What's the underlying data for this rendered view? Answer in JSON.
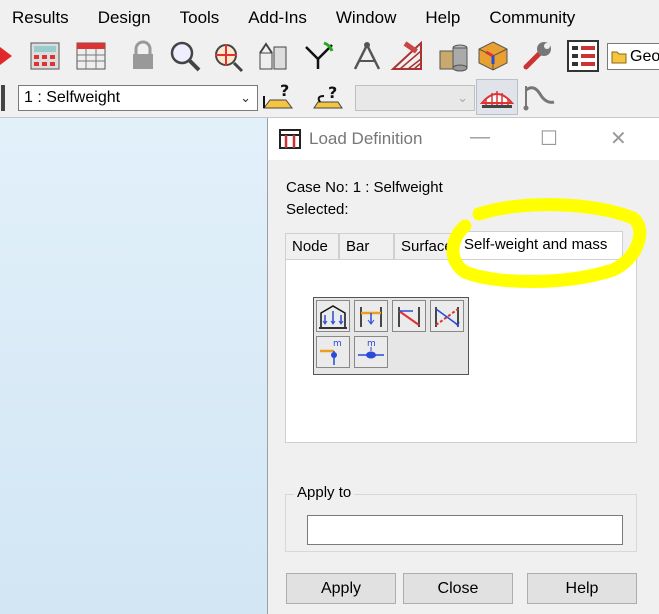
{
  "menu": [
    "Results",
    "Design",
    "Tools",
    "Add-Ins",
    "Window",
    "Help",
    "Community"
  ],
  "toolbar": {
    "load_case_value": "1 : Selfweight",
    "truncated_combo_text": "Geo",
    "icons": [
      "calculator-icon",
      "tables-icon",
      "lock-icon",
      "zoom-icon",
      "pan-icon",
      "structure-icon",
      "supports-icon",
      "measure-icon",
      "truss-icon",
      "cylinder-icon",
      "cube-icon",
      "wrench-icon",
      "layout-icon"
    ]
  },
  "dialog": {
    "title": "Load Definition",
    "case_label": "Case No: 1 : Selfweight",
    "selected_label": "Selected:",
    "tabs": [
      "Node",
      "Bar",
      "Surface",
      "Self-weight and mass"
    ],
    "active_tab": "Self-weight and mass",
    "apply_to_label": "Apply to",
    "apply_to_value": "",
    "buttons": {
      "apply": "Apply",
      "close": "Close",
      "help": "Help"
    },
    "tool_buttons": [
      "frame-load-icon",
      "bar-load-icon",
      "diagonal-load-icon",
      "trapezoid-load-icon",
      "nodal-mass-icon",
      "bar-mass-icon"
    ]
  },
  "colors": {
    "highlight": "#ffff00",
    "accent_blue": "#2a4bd7",
    "accent_red": "#d02020"
  }
}
